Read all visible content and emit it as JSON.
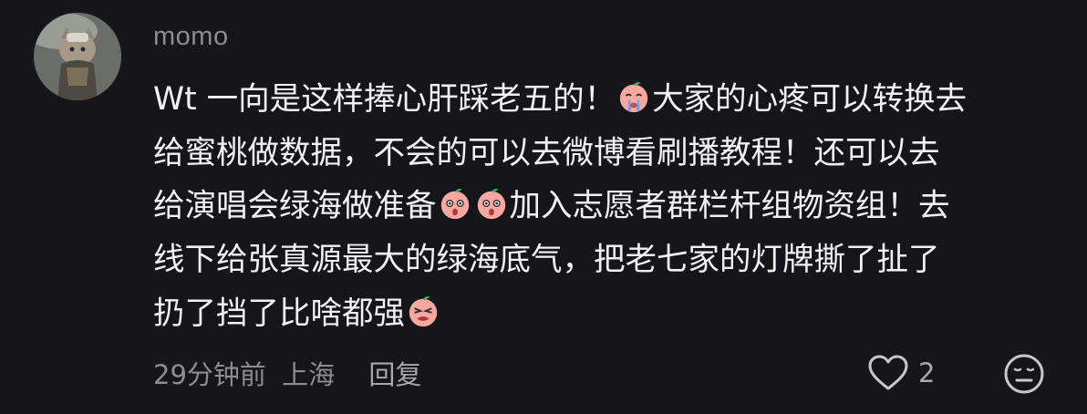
{
  "comment": {
    "username": "momo",
    "lines": [
      [
        "Wt 一向是这样捧心肝踩老五的！",
        "[emoji:crying-peach]",
        "大家的心疼可以转换去"
      ],
      [
        "给蜜桃做数据，不会的可以去微博看刷播教程！还可以去"
      ],
      [
        "给演唱会绿海做准备",
        "[emoji:shocked-peach]",
        "[emoji:shocked-peach]",
        "加入志愿者群栏杆组物资组！去"
      ],
      [
        "线下给张真源最大的绿海底气，把老七家的灯牌撕了扯了"
      ],
      [
        "扔了挡了比啥都强",
        "[emoji:angry-peach]"
      ]
    ],
    "line_text": {
      "l1a": "Wt 一向是这样捧心肝踩老五的！",
      "l1b": "大家的心疼可以转换去",
      "l2": "给蜜桃做数据，不会的可以去微博看刷播教程！还可以去",
      "l3a": "给演唱会绿海做准备",
      "l3b": "加入志愿者群栏杆组物资组！去",
      "l4": "线下给张真源最大的绿海底气，把老七家的灯牌撕了扯了",
      "l5": "扔了挡了比啥都强"
    },
    "emojis": [
      "crying-peach-emoji",
      "shocked-peach-emoji",
      "shocked-peach-emoji",
      "angry-peach-emoji"
    ],
    "time": "29分钟前",
    "location": "上海",
    "reply_label": "回复",
    "like_count": "2"
  },
  "icons": {
    "like": "heart-outline-icon",
    "dislike": "meh-face-icon"
  },
  "colors": {
    "background": "#161519",
    "text": "#f1f1f2",
    "muted": "#8c8c91",
    "emoji_peach": "#f7a8a0"
  }
}
